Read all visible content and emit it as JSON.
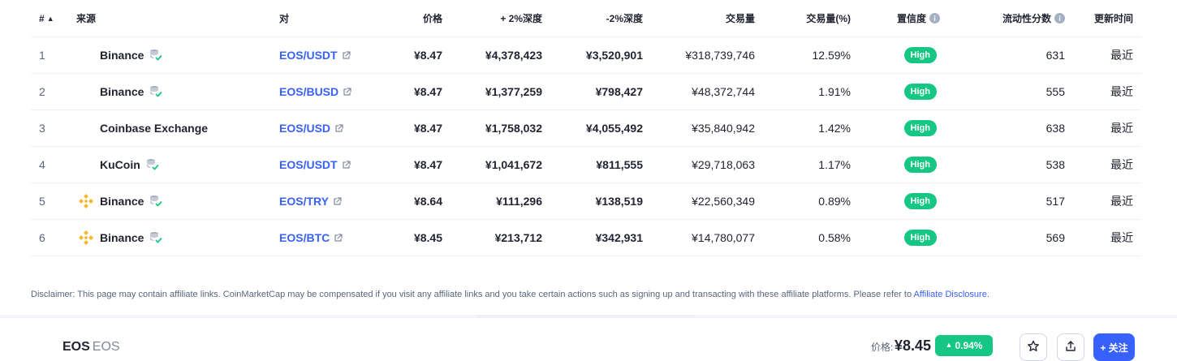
{
  "colors": {
    "accent": "#3861fb",
    "positive": "#16c784",
    "binance_yellow": "#f3ba2f",
    "text_primary": "#222531",
    "text_muted": "#58667e"
  },
  "table": {
    "headers": {
      "rank": "#",
      "source": "来源",
      "pair": "对",
      "price": "价格",
      "depth_plus": "+ 2%深度",
      "depth_minus": "-2%深度",
      "volume": "交易量",
      "volume_pct": "交易量(%)",
      "confidence": "置信度",
      "liquidity": "流动性分数",
      "updated": "更新时间"
    },
    "rows": [
      {
        "rank": "1",
        "exchange": "Binance",
        "logo": "none",
        "pair": "EOS/USDT",
        "price": "¥8.47",
        "depth_plus": "¥4,378,423",
        "depth_minus": "¥3,520,901",
        "volume": "¥318,739,746",
        "volume_pct": "12.59%",
        "confidence": "High",
        "liquidity": "631",
        "updated": "最近"
      },
      {
        "rank": "2",
        "exchange": "Binance",
        "logo": "none",
        "pair": "EOS/BUSD",
        "price": "¥8.47",
        "depth_plus": "¥1,377,259",
        "depth_minus": "¥798,427",
        "volume": "¥48,372,744",
        "volume_pct": "1.91%",
        "confidence": "High",
        "liquidity": "555",
        "updated": "最近"
      },
      {
        "rank": "3",
        "exchange": "Coinbase Exchange",
        "logo": "none",
        "pair": "EOS/USD",
        "price": "¥8.47",
        "depth_plus": "¥1,758,032",
        "depth_minus": "¥4,055,492",
        "volume": "¥35,840,942",
        "volume_pct": "1.42%",
        "confidence": "High",
        "liquidity": "638",
        "updated": "最近"
      },
      {
        "rank": "4",
        "exchange": "KuCoin",
        "logo": "none",
        "pair": "EOS/USDT",
        "price": "¥8.47",
        "depth_plus": "¥1,041,672",
        "depth_minus": "¥811,555",
        "volume": "¥29,718,063",
        "volume_pct": "1.17%",
        "confidence": "High",
        "liquidity": "538",
        "updated": "最近"
      },
      {
        "rank": "5",
        "exchange": "Binance",
        "logo": "binance-logo-icon",
        "pair": "EOS/TRY",
        "price": "¥8.64",
        "depth_plus": "¥111,296",
        "depth_minus": "¥138,519",
        "volume": "¥22,560,349",
        "volume_pct": "0.89%",
        "confidence": "High",
        "liquidity": "517",
        "updated": "最近"
      },
      {
        "rank": "6",
        "exchange": "Binance",
        "logo": "binance-logo-icon",
        "pair": "EOS/BTC",
        "price": "¥8.45",
        "depth_plus": "¥213,712",
        "depth_minus": "¥342,931",
        "volume": "¥14,780,077",
        "volume_pct": "0.58%",
        "confidence": "High",
        "liquidity": "569",
        "updated": "最近"
      }
    ]
  },
  "disclaimer": {
    "text": "Disclaimer: This page may contain affiliate links. CoinMarketCap may be compensated if you visit any affiliate links and you take certain actions such as signing up and transacting with these affiliate platforms. Please refer to ",
    "link": "Affiliate Disclosure",
    "end": "."
  },
  "footer": {
    "coin_name": "EOS",
    "coin_symbol": "EOS",
    "price_label": "价格:",
    "price": "¥8.45",
    "change": "0.94%",
    "follow_label": "+ 关注"
  }
}
